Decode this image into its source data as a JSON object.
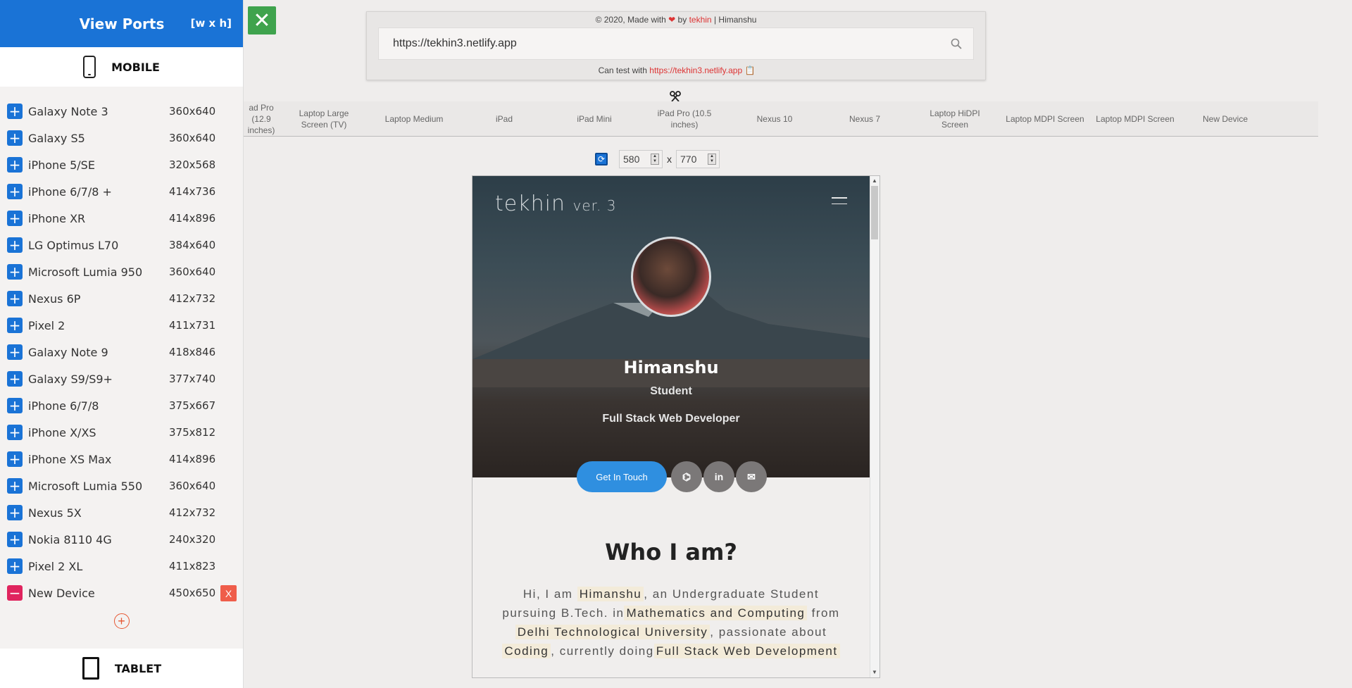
{
  "sidebar": {
    "title": "View Ports",
    "subtitle": "[w x h]",
    "mobile_label": "MOBILE",
    "tablet_label": "TABLET",
    "devices": [
      {
        "name": "Galaxy Note 3",
        "size": "360x640"
      },
      {
        "name": "Galaxy S5",
        "size": "360x640"
      },
      {
        "name": "iPhone 5/SE",
        "size": "320x568"
      },
      {
        "name": "iPhone 6/7/8 +",
        "size": "414x736"
      },
      {
        "name": "iPhone XR",
        "size": "414x896"
      },
      {
        "name": "LG Optimus L70",
        "size": "384x640"
      },
      {
        "name": "Microsoft Lumia 950",
        "size": "360x640"
      },
      {
        "name": "Nexus 6P",
        "size": "412x732"
      },
      {
        "name": "Pixel 2",
        "size": "411x731"
      },
      {
        "name": "Galaxy Note 9",
        "size": "418x846"
      },
      {
        "name": "Galaxy S9/S9+",
        "size": "377x740"
      },
      {
        "name": "iPhone 6/7/8",
        "size": "375x667"
      },
      {
        "name": "iPhone X/XS",
        "size": "375x812"
      },
      {
        "name": "iPhone XS Max",
        "size": "414x896"
      },
      {
        "name": "Microsoft Lumia 550",
        "size": "360x640"
      },
      {
        "name": "Nexus 5X",
        "size": "412x732"
      },
      {
        "name": "Nokia 8110 4G",
        "size": "240x320"
      },
      {
        "name": "Pixel 2 XL",
        "size": "411x823"
      }
    ],
    "custom_device": {
      "name": "New Device",
      "size": "450x650",
      "remove_label": "X"
    }
  },
  "header": {
    "credit_prefix": "© 2020, Made with",
    "credit_by": "by",
    "credit_brand": "tekhin",
    "credit_suffix": "| Himanshu",
    "url_value": "https://tekhin3.netlify.app",
    "test_prefix": "Can test with",
    "test_link": "https://tekhin3.netlify.app"
  },
  "tabs": [
    "ad Pro (12.9 inches)",
    "Laptop Large Screen (TV)",
    "Laptop Medium",
    "iPad",
    "iPad Mini",
    "iPad Pro (10.5 inches)",
    "Nexus 10",
    "Nexus 7",
    "Laptop HiDPI Screen",
    "Laptop MDPI Screen",
    "Laptop MDPI Screen",
    "New Device"
  ],
  "dimensions": {
    "width": "580",
    "separator": "x",
    "height": "770"
  },
  "preview": {
    "logo_main": "tekhin",
    "logo_ver": "ver. 3",
    "name": "Himanshu",
    "role": "Student",
    "description": "Full Stack Web Developer",
    "cta": "Get In Touch",
    "section_title": "Who I am?",
    "about_parts": [
      {
        "t": "Hi, I am ",
        "h": false
      },
      {
        "t": "Himanshu",
        "h": true
      },
      {
        "t": ", an Undergraduate Student pursuing B.Tech. in",
        "h": false
      },
      {
        "t": "Mathematics and Computing",
        "h": true
      },
      {
        "t": " from ",
        "h": false
      },
      {
        "t": "Delhi Technological University",
        "h": true
      },
      {
        "t": ", passionate about ",
        "h": false
      },
      {
        "t": "Coding",
        "h": true
      },
      {
        "t": ", currently doing",
        "h": false
      },
      {
        "t": "Full Stack Web Development",
        "h": true
      }
    ]
  },
  "colors": {
    "accent": "#1a73d6",
    "close": "#3fa34d",
    "remove": "#e0245e"
  }
}
